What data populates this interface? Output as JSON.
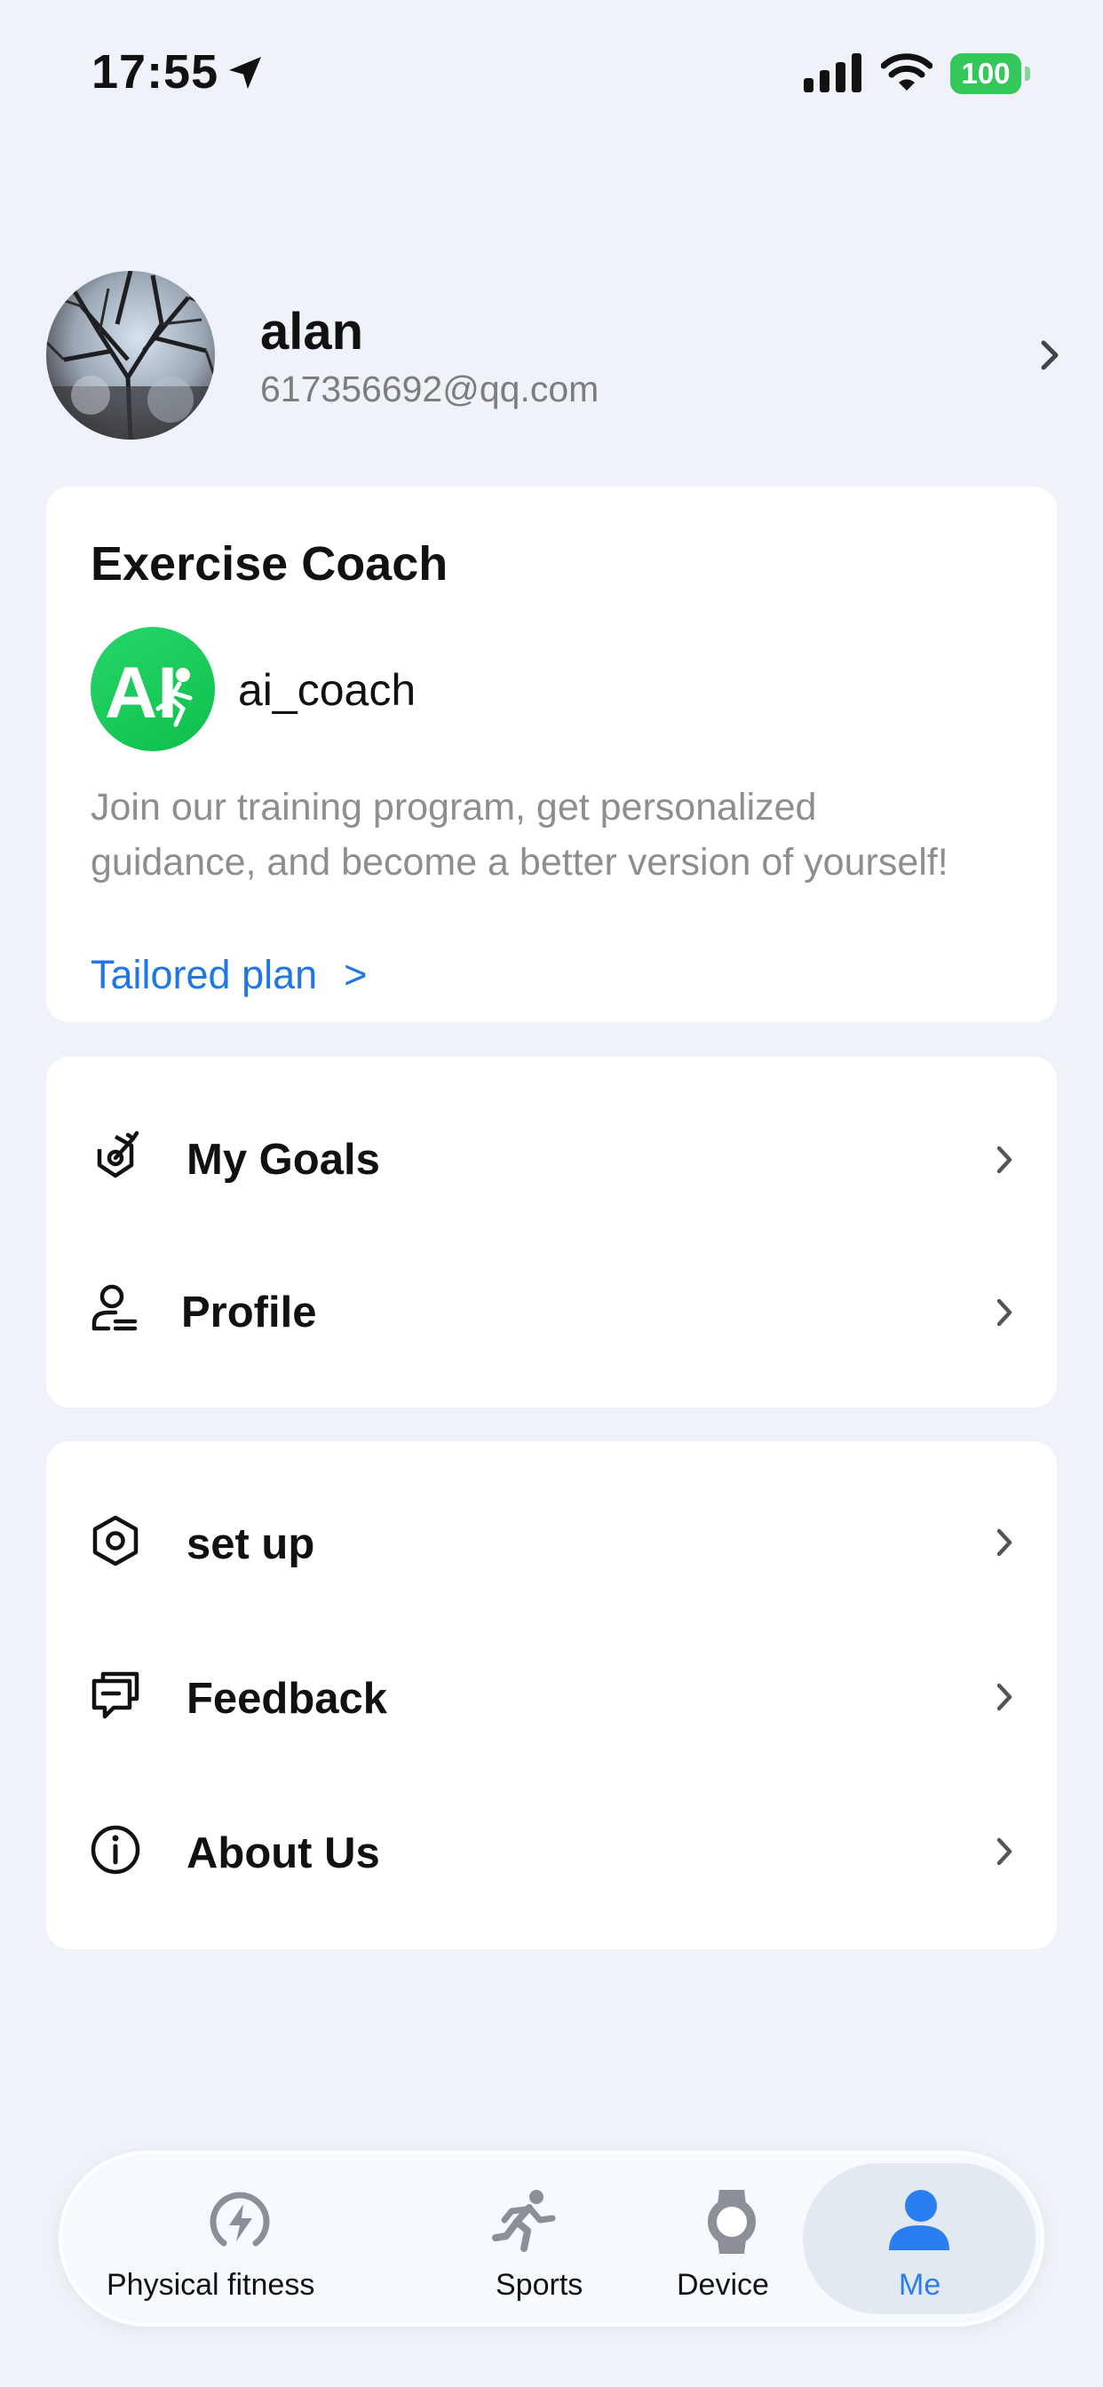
{
  "status_bar": {
    "time": "17:55",
    "battery": "100"
  },
  "user": {
    "name": "alan",
    "email": "617356692@qq.com"
  },
  "coach_card": {
    "title": "Exercise Coach",
    "coach_name": "ai_coach",
    "logo_text": "AI",
    "description": "Join our training program, get personalized guidance, and become a better version of yourself!",
    "link_label": "Tailored plan",
    "link_arrow": ">"
  },
  "menu_group_1": [
    {
      "label": "My Goals",
      "icon": "target-icon"
    },
    {
      "label": "Profile",
      "icon": "profile-icon"
    }
  ],
  "menu_group_2": [
    {
      "label": "set up",
      "icon": "settings-icon"
    },
    {
      "label": "Feedback",
      "icon": "feedback-icon"
    },
    {
      "label": "About Us",
      "icon": "info-icon"
    }
  ],
  "tab_bar": {
    "tabs": [
      {
        "label": "Physical fitness",
        "icon": "fitness-bolt-icon"
      },
      {
        "label": "Sports",
        "icon": "running-icon"
      },
      {
        "label": "Device",
        "icon": "watch-icon"
      },
      {
        "label": "Me",
        "icon": "person-icon",
        "selected": true
      }
    ]
  },
  "colors": {
    "accent": "#2176e6",
    "tab_active": "#2a7ef0",
    "tab_inactive": "#8a8f98",
    "coach_green": "#1ecb5e"
  }
}
